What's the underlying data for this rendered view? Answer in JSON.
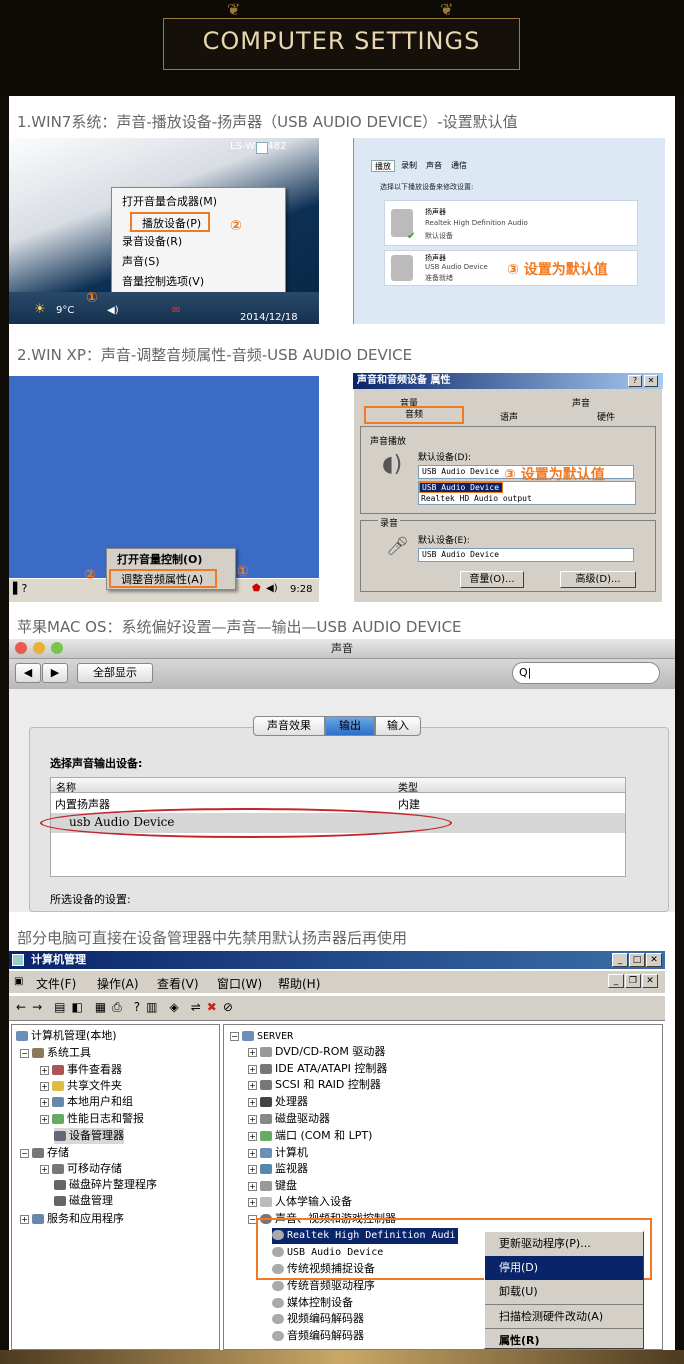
{
  "header": {
    "title": "COMPUTER SETTINGS"
  },
  "win7": {
    "caption": "1.WIN7系统：声音-播放设备-扬声器（USB AUDIO DEVICE）-设置默认值",
    "machine_label": "LS-WXL482",
    "context_menu": [
      "打开音量合成器(M)",
      "播放设备(P)",
      "录音设备(R)",
      "声音(S)",
      "音量控制选项(V)"
    ],
    "step1": "①",
    "step2": "②",
    "step3": "③ 设置为默认值",
    "temp": "9°C",
    "date": "2014/12/18",
    "dialog": {
      "tabs": [
        "播放",
        "录制",
        "声音",
        "通信"
      ],
      "instruction": "选择以下播放设备来修改设置:",
      "devices": [
        {
          "name": "扬声器",
          "desc": "Realtek High Definition Audio",
          "status": "默认设备"
        },
        {
          "name": "扬声器",
          "desc": "USB Audio Device",
          "status": "准备就绪"
        }
      ]
    }
  },
  "winxp": {
    "caption": "2.WIN XP：声音-调整音频属性-音频-USB AUDIO DEVICE",
    "dialog_title": "声音和音频设备 属性",
    "tabs_top": [
      "音量",
      "声音"
    ],
    "tabs_bottom": [
      "音频",
      "语声",
      "硬件"
    ],
    "playback_group": "声音播放",
    "record_group": "录音",
    "default_device_label": "默认设备(D):",
    "default_device_label2": "默认设备(E):",
    "playback_selected": "USB Audio Device",
    "dropdown_options": [
      "USB Audio Device",
      "Realtek HD Audio output"
    ],
    "record_selected": "USB Audio Device",
    "step3": "③ 设置为默认值",
    "volume_btn": "音量(O)...",
    "advanced_btn": "高级(D)...",
    "context_menu": [
      "打开音量控制(O)",
      "调整音频属性(A)"
    ],
    "step1": "①",
    "step2": "②",
    "time": "9:28"
  },
  "mac": {
    "caption": "苹果MAC OS：系统偏好设置—声音—输出—USB AUDIO DEVICE",
    "window_title": "声音",
    "show_all": "全部显示",
    "search_placeholder": "Q|",
    "tabs": [
      "声音效果",
      "输出",
      "输入"
    ],
    "select_label": "选择声音输出设备:",
    "col_name": "名称",
    "col_type": "类型",
    "rows": [
      {
        "name": "内置扬声器",
        "type": "内建"
      },
      {
        "name": "usb Audio Device",
        "type": ""
      }
    ],
    "settings_label": "所选设备的设置:"
  },
  "devmgr": {
    "caption": "部分电脑可直接在设备管理器中先禁用默认扬声器后再使用",
    "window_title": "计算机管理",
    "menu": [
      "文件(F)",
      "操作(A)",
      "查看(V)",
      "窗口(W)",
      "帮助(H)"
    ],
    "left_tree": [
      "计算机管理(本地)",
      "系统工具",
      "事件查看器",
      "共享文件夹",
      "本地用户和组",
      "性能日志和警报",
      "设备管理器",
      "存储",
      "可移动存储",
      "磁盘碎片整理程序",
      "磁盘管理",
      "服务和应用程序"
    ],
    "right_tree": [
      "SERVER",
      "DVD/CD-ROM 驱动器",
      "IDE ATA/ATAPI 控制器",
      "SCSI 和 RAID 控制器",
      "处理器",
      "磁盘驱动器",
      "端口 (COM 和 LPT)",
      "计算机",
      "监视器",
      "键盘",
      "人体学输入设备",
      "声音、视频和游戏控制器",
      "Realtek High Definition Audi",
      "USB Audio Device",
      "传统视频捕捉设备",
      "传统音频驱动程序",
      "媒体控制设备",
      "视频编码解码器",
      "音频编码解码器"
    ],
    "context_menu": [
      "更新驱动程序(P)...",
      "停用(D)",
      "卸载(U)",
      "扫描检测硬件改动(A)",
      "属性(R)"
    ]
  }
}
